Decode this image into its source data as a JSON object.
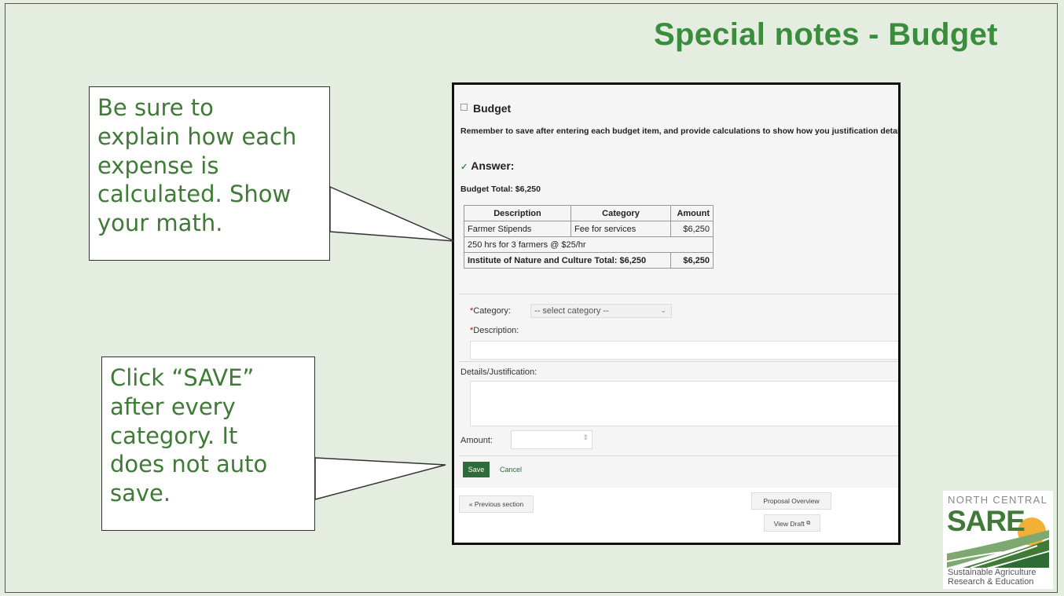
{
  "slide": {
    "title": "Special notes - Budget"
  },
  "callouts": {
    "top": [
      "Be sure to",
      "explain how each",
      "expense is",
      "calculated. Show",
      "your math."
    ],
    "bottom": [
      "Click “SAVE”",
      "after every",
      "category. It",
      "does not auto",
      "save."
    ]
  },
  "budget": {
    "heading": "Budget",
    "instruction": "Remember to save after entering each budget item, and provide calculations to show how you justification details.",
    "answer_label": "Answer:",
    "total": "Budget Total: $6,250",
    "table": {
      "headers": [
        "Description",
        "Category",
        "Amount"
      ],
      "row1": [
        "Farmer Stipends",
        "Fee for services",
        "$6,250"
      ],
      "detail": "250 hrs for 3 farmers @ $25/hr",
      "footer_label": "Institute of Nature and Culture Total: $6,250",
      "footer_amount": "$6,250"
    }
  },
  "form": {
    "category_label": "Category:",
    "category_value": "-- select category --",
    "description_label": "Description:",
    "details_label": "Details/Justification:",
    "amount_label": "Amount:",
    "save_label": "Save",
    "cancel_label": "Cancel"
  },
  "nav": {
    "previous": "« Previous section",
    "overview": "Proposal Overview",
    "view_draft": "View Draft"
  },
  "logo": {
    "line1": "NORTH CENTRAL",
    "name": "SARE",
    "tag1": "Sustainable Agriculture",
    "tag2": "Research & Education"
  },
  "colors": {
    "title_green": "#3a8d3c",
    "callout_text": "#3f7a37",
    "save_button": "#2e6b3a",
    "background": "#e4ede0"
  },
  "icons": {
    "expand": "square-icon",
    "answer": "check-icon",
    "dropdown": "chevron-down-icon",
    "stepper": "stepper-icon",
    "external": "external-link-icon"
  }
}
